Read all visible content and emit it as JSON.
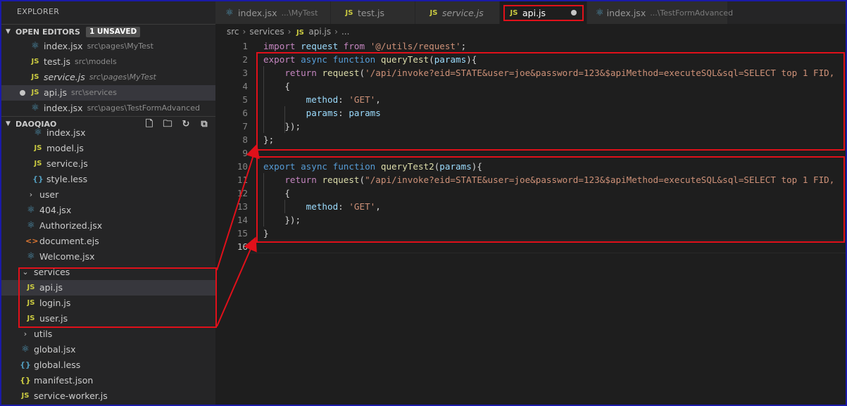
{
  "sidebar": {
    "title": "EXPLORER",
    "open_editors": {
      "label": "OPEN EDITORS",
      "badge": "1 UNSAVED",
      "items": [
        {
          "name": "index.jsx",
          "desc": "src\\pages\\MyTest",
          "icon": "react-icon"
        },
        {
          "name": "test.js",
          "desc": "src\\models",
          "icon": "js-icon"
        },
        {
          "name": "service.js",
          "desc": "src\\pages\\MyTest",
          "icon": "js-icon"
        },
        {
          "name": "api.js",
          "desc": "src\\services",
          "icon": "js-icon"
        },
        {
          "name": "index.jsx",
          "desc": "src\\pages\\TestFormAdvanced",
          "icon": "react-icon"
        }
      ]
    },
    "folder": {
      "label": "DAOQIAO",
      "tree": [
        {
          "name": "index.jsx",
          "icon": "react-icon"
        },
        {
          "name": "model.js",
          "icon": "js-icon"
        },
        {
          "name": "service.js",
          "icon": "js-icon"
        },
        {
          "name": "style.less",
          "icon": "less-icon"
        },
        {
          "name": "user",
          "icon": "chevron-right-icon"
        },
        {
          "name": "404.jsx",
          "icon": "react-icon"
        },
        {
          "name": "Authorized.jsx",
          "icon": "react-icon"
        },
        {
          "name": "document.ejs",
          "icon": "ejs-icon"
        },
        {
          "name": "Welcome.jsx",
          "icon": "react-icon"
        },
        {
          "name": "services",
          "icon": "chevron-down-icon"
        },
        {
          "name": "api.js",
          "icon": "js-icon"
        },
        {
          "name": "login.js",
          "icon": "js-icon"
        },
        {
          "name": "user.js",
          "icon": "js-icon"
        },
        {
          "name": "utils",
          "icon": "chevron-right-icon"
        },
        {
          "name": "global.jsx",
          "icon": "react-icon"
        },
        {
          "name": "global.less",
          "icon": "less-icon"
        },
        {
          "name": "manifest.json",
          "icon": "json-icon"
        },
        {
          "name": "service-worker.js",
          "icon": "js-icon"
        }
      ]
    }
  },
  "tabs": [
    {
      "name": "index.jsx",
      "desc": "...\\MyTest",
      "icon": "react-icon"
    },
    {
      "name": "test.js",
      "desc": "",
      "icon": "js-icon"
    },
    {
      "name": "service.js",
      "desc": "",
      "icon": "js-icon"
    },
    {
      "name": "api.js",
      "desc": "",
      "icon": "js-icon"
    },
    {
      "name": "index.jsx",
      "desc": "...\\TestFormAdvanced",
      "icon": "react-icon"
    }
  ],
  "breadcrumb": {
    "part1": "src",
    "part2": "services",
    "part3": "api.js",
    "part4": "..."
  },
  "editor": {
    "line_numbers": [
      "1",
      "2",
      "3",
      "4",
      "5",
      "6",
      "7",
      "8",
      "9",
      "10",
      "11",
      "12",
      "13",
      "14",
      "15",
      "16"
    ],
    "code": {
      "l1_kw": "import",
      "l1_id": "request",
      "l1_from": "from",
      "l1_str": "'@/utils/request'",
      "l1_end": ";",
      "l2_a": "export",
      "l2_b": "async",
      "l2_c": "function",
      "l2_fn": "queryTest",
      "l2_p": "params",
      "l2_end": "){",
      "l3_ret": "return",
      "l3_fn": "request",
      "l3_str": "'/api/invoke?eid=STATE&user=joe&password=123&$apiMethod=executeSQL&sql=SELECT top 1 FID,",
      "l4": "{",
      "l5_key": "method",
      "l5_str": "'GET'",
      "l5_end": ",",
      "l6_key": "params",
      "l6_val": "params",
      "l7": "});",
      "l8": "};",
      "l10_a": "export",
      "l10_b": "async",
      "l10_c": "function",
      "l10_fn": "queryTest2",
      "l10_p": "params",
      "l10_end": "){",
      "l11_ret": "return",
      "l11_fn": "request",
      "l11_str": "\"/api/invoke?eid=STATE&user=joe&password=123&$apiMethod=executeSQL&sql=SELECT top 1 FID,",
      "l12": "{",
      "l13_key": "method",
      "l13_str": "'GET'",
      "l13_end": ",",
      "l14": "});",
      "l15": "}"
    }
  },
  "colors": {
    "annotation": "#e0101a",
    "accent_frame": "#1a1aa8"
  }
}
